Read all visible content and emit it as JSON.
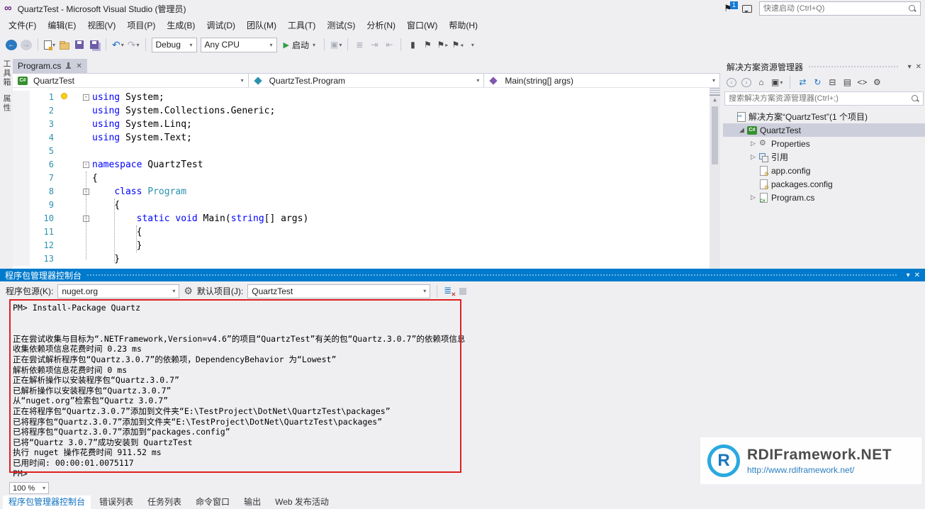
{
  "titlebar": {
    "title": "QuartzTest - Microsoft Visual Studio (管理员)",
    "badge": "1",
    "quick_launch": "快速启动 (Ctrl+Q)"
  },
  "menus": [
    "文件(F)",
    "编辑(E)",
    "视图(V)",
    "项目(P)",
    "生成(B)",
    "调试(D)",
    "团队(M)",
    "工具(T)",
    "测试(S)",
    "分析(N)",
    "窗口(W)",
    "帮助(H)"
  ],
  "toolbar": {
    "config": "Debug",
    "platform": "Any CPU",
    "start": "启动"
  },
  "left_tabs": [
    "工具箱",
    "属性"
  ],
  "editor": {
    "tab": "Program.cs",
    "nav": {
      "project": "QuartzTest",
      "type": "QuartzTest.Program",
      "member": "Main(string[] args)"
    },
    "lines": [
      {
        "n": 1,
        "fold": true,
        "tokens": [
          [
            "k",
            "using"
          ],
          [
            "p",
            " System;"
          ]
        ]
      },
      {
        "n": 2,
        "fold": false,
        "tokens": [
          [
            "k",
            "using"
          ],
          [
            "p",
            " System.Collections.Generic;"
          ]
        ]
      },
      {
        "n": 3,
        "fold": false,
        "tokens": [
          [
            "k",
            "using"
          ],
          [
            "p",
            " System.Linq;"
          ]
        ]
      },
      {
        "n": 4,
        "fold": false,
        "tokens": [
          [
            "k",
            "using"
          ],
          [
            "p",
            " System.Text;"
          ]
        ]
      },
      {
        "n": 5,
        "fold": false,
        "tokens": []
      },
      {
        "n": 6,
        "fold": true,
        "tokens": [
          [
            "k",
            "namespace"
          ],
          [
            "p",
            " QuartzTest"
          ]
        ]
      },
      {
        "n": 7,
        "fold": false,
        "tokens": [
          [
            "p",
            "{"
          ]
        ]
      },
      {
        "n": 8,
        "fold": true,
        "tokens": [
          [
            "p",
            "    "
          ],
          [
            "k",
            "class"
          ],
          [
            "p",
            " "
          ],
          [
            "t",
            "Program"
          ]
        ]
      },
      {
        "n": 9,
        "fold": false,
        "tokens": [
          [
            "p",
            "    {"
          ]
        ]
      },
      {
        "n": 10,
        "fold": true,
        "tokens": [
          [
            "p",
            "        "
          ],
          [
            "k",
            "static"
          ],
          [
            "p",
            " "
          ],
          [
            "k",
            "void"
          ],
          [
            "p",
            " Main("
          ],
          [
            "k",
            "string"
          ],
          [
            "p",
            "[] args)"
          ]
        ]
      },
      {
        "n": 11,
        "fold": false,
        "tokens": [
          [
            "p",
            "        {"
          ]
        ]
      },
      {
        "n": 12,
        "fold": false,
        "tokens": [
          [
            "p",
            "        }"
          ]
        ]
      },
      {
        "n": 13,
        "fold": false,
        "tokens": [
          [
            "p",
            "    }"
          ]
        ]
      }
    ]
  },
  "solution_explorer": {
    "title": "解决方案资源管理器",
    "search_placeholder": "搜索解决方案资源管理器(Ctrl+;)",
    "items": [
      {
        "label": "解决方案“QuartzTest”(1 个项目)",
        "icon": "solution",
        "level": 0,
        "arrow": "none",
        "selected": false
      },
      {
        "label": "QuartzTest",
        "icon": "csproj",
        "level": 1,
        "arrow": "expanded",
        "selected": true
      },
      {
        "label": "Properties",
        "icon": "properties",
        "level": 2,
        "arrow": "collapsed",
        "selected": false
      },
      {
        "label": "引用",
        "icon": "references",
        "level": 2,
        "arrow": "collapsed",
        "selected": false
      },
      {
        "label": "app.config",
        "icon": "config",
        "level": 2,
        "arrow": "none",
        "selected": false
      },
      {
        "label": "packages.config",
        "icon": "config",
        "level": 2,
        "arrow": "none",
        "selected": false
      },
      {
        "label": "Program.cs",
        "icon": "csfile",
        "level": 2,
        "arrow": "collapsed",
        "selected": false
      }
    ]
  },
  "console": {
    "title": "程序包管理器控制台",
    "source_label": "程序包源(K):",
    "source_value": "nuget.org",
    "project_label": "默认项目(J):",
    "project_value": "QuartzTest",
    "zoom": "100 %",
    "output": [
      "PM> Install-Package Quartz",
      "",
      "",
      "正在尝试收集与目标为“.NETFramework,Version=v4.6”的项目“QuartzTest”有关的包“Quartz.3.0.7”的依赖项信息",
      "收集依赖项信息花费时间 0.23 ms",
      "正在尝试解析程序包“Quartz.3.0.7”的依赖项，DependencyBehavior 为“Lowest”",
      "解析依赖项信息花费时间 0 ms",
      "正在解析操作以安装程序包“Quartz.3.0.7”",
      "已解析操作以安装程序包“Quartz.3.0.7”",
      "从“nuget.org”检索包“Quartz 3.0.7”",
      "正在将程序包“Quartz.3.0.7”添加到文件夹“E:\\TestProject\\DotNet\\QuartzTest\\packages”",
      "已将程序包“Quartz.3.0.7”添加到文件夹“E:\\TestProject\\DotNet\\QuartzTest\\packages”",
      "已将程序包“Quartz.3.0.7”添加到“packages.config”",
      "已将“Quartz 3.0.7”成功安装到 QuartzTest",
      "执行 nuget 操作花费时间 911.52 ms",
      "已用时间: 00:00:01.0075117",
      "PM>"
    ]
  },
  "bottom_tabs": [
    "程序包管理器控制台",
    "错误列表",
    "任务列表",
    "命令窗口",
    "输出",
    "Web 发布活动"
  ],
  "watermark": {
    "logo_letter": "R",
    "name": "RDIFramework.NET",
    "url": "http://www.rdiframework.net/"
  }
}
